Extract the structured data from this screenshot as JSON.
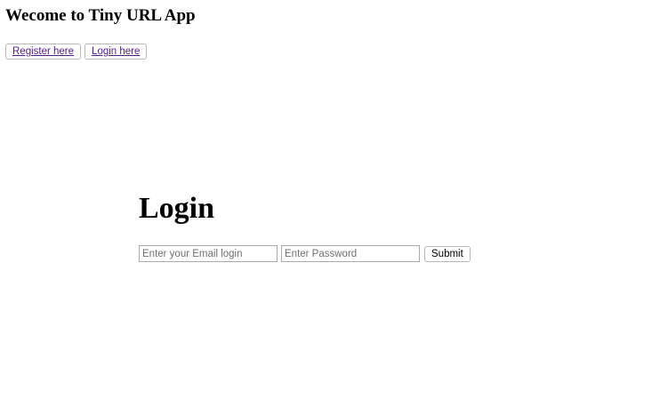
{
  "header": {
    "title": "Wecome to Tiny URL App"
  },
  "nav": {
    "register_label": "Register here",
    "login_label": "Login here"
  },
  "login": {
    "title": "Login",
    "email": {
      "value": "",
      "placeholder": "Enter your Email login"
    },
    "password": {
      "value": "",
      "placeholder": "Enter Password"
    },
    "submit_label": "Submit"
  },
  "colors": {
    "link": "#551a8b",
    "background": "#ffffff",
    "text": "#000000"
  }
}
